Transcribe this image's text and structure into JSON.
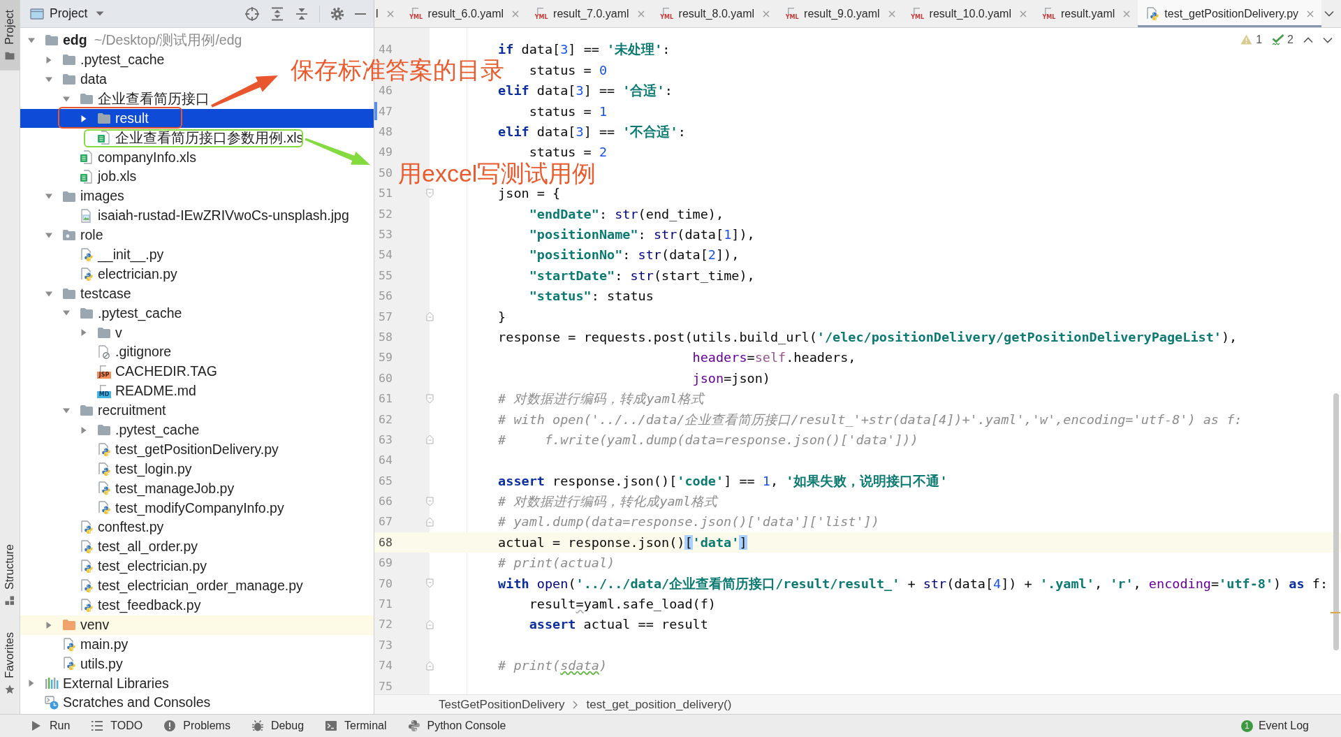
{
  "tool_strip": {
    "tabs": [
      {
        "label": "Project",
        "selected": true
      },
      {
        "label": "Structure",
        "selected": false
      },
      {
        "label": "Favorites",
        "selected": false
      }
    ]
  },
  "project_panel": {
    "title": "Project",
    "tree": [
      {
        "label": "edg",
        "path": "~/Desktop/测试用例/edg",
        "kind": "root",
        "expanded": true,
        "selected": false,
        "highlighted": false,
        "children": [
          {
            "label": ".pytest_cache",
            "kind": "folder",
            "expanded": false,
            "selected": false,
            "highlighted": false
          },
          {
            "label": "data",
            "kind": "folder",
            "expanded": true,
            "selected": false,
            "highlighted": false,
            "children": [
              {
                "label": "企业查看简历接口",
                "kind": "folder",
                "expanded": true,
                "selected": false,
                "highlighted": false,
                "children": [
                  {
                    "label": "result",
                    "kind": "folder",
                    "expanded": false,
                    "selected": true,
                    "highlighted": false
                  },
                  {
                    "label": "企业查看简历接口参数用例.xls",
                    "kind": "xls",
                    "selected": false,
                    "highlighted": false
                  }
                ]
              },
              {
                "label": "companyInfo.xls",
                "kind": "xls",
                "selected": false,
                "highlighted": false
              },
              {
                "label": "job.xls",
                "kind": "xls",
                "selected": false,
                "highlighted": false
              }
            ]
          },
          {
            "label": "images",
            "kind": "folder",
            "expanded": true,
            "selected": false,
            "highlighted": false,
            "children": [
              {
                "label": "isaiah-rustad-IEwZRIVwoCs-unsplash.jpg",
                "kind": "image",
                "selected": false,
                "highlighted": false
              }
            ]
          },
          {
            "label": "role",
            "kind": "package",
            "expanded": true,
            "selected": false,
            "highlighted": false,
            "children": [
              {
                "label": "__init__.py",
                "kind": "python",
                "selected": false,
                "highlighted": false
              },
              {
                "label": "electrician.py",
                "kind": "python",
                "selected": false,
                "highlighted": false
              }
            ]
          },
          {
            "label": "testcase",
            "kind": "folder",
            "expanded": true,
            "selected": false,
            "highlighted": false,
            "children": [
              {
                "label": ".pytest_cache",
                "kind": "folder",
                "expanded": true,
                "selected": false,
                "highlighted": false,
                "children": [
                  {
                    "label": "v",
                    "kind": "folder",
                    "expanded": false,
                    "selected": false,
                    "highlighted": false
                  },
                  {
                    "label": ".gitignore",
                    "kind": "gitignore",
                    "selected": false,
                    "highlighted": false
                  },
                  {
                    "label": "CACHEDIR.TAG",
                    "kind": "jsp",
                    "badge": "JSP",
                    "selected": false,
                    "highlighted": false
                  },
                  {
                    "label": "README.md",
                    "kind": "md",
                    "badge": "MD",
                    "selected": false,
                    "highlighted": false
                  }
                ]
              },
              {
                "label": "recruitment",
                "kind": "folder",
                "expanded": true,
                "selected": false,
                "highlighted": false,
                "children": [
                  {
                    "label": ".pytest_cache",
                    "kind": "folder",
                    "expanded": false,
                    "selected": false,
                    "highlighted": false
                  },
                  {
                    "label": "test_getPositionDelivery.py",
                    "kind": "python",
                    "selected": false,
                    "highlighted": false
                  },
                  {
                    "label": "test_login.py",
                    "kind": "python",
                    "selected": false,
                    "highlighted": false
                  },
                  {
                    "label": "test_manageJob.py",
                    "kind": "python",
                    "selected": false,
                    "highlighted": false
                  },
                  {
                    "label": "test_modifyCompanyInfo.py",
                    "kind": "python",
                    "selected": false,
                    "highlighted": false
                  }
                ]
              },
              {
                "label": "conftest.py",
                "kind": "python",
                "selected": false,
                "highlighted": false
              },
              {
                "label": "test_all_order.py",
                "kind": "python",
                "selected": false,
                "highlighted": false
              },
              {
                "label": "test_electrician.py",
                "kind": "python",
                "selected": false,
                "highlighted": false
              },
              {
                "label": "test_electrician_order_manage.py",
                "kind": "python",
                "selected": false,
                "highlighted": false
              },
              {
                "label": "test_feedback.py",
                "kind": "python",
                "selected": false,
                "highlighted": false
              }
            ]
          },
          {
            "label": "venv",
            "kind": "excluded_folder",
            "expanded": false,
            "selected": false,
            "highlighted": true
          },
          {
            "label": "main.py",
            "kind": "python",
            "selected": false,
            "highlighted": false
          },
          {
            "label": "utils.py",
            "kind": "python",
            "selected": false,
            "highlighted": false
          }
        ]
      },
      {
        "label": "External Libraries",
        "kind": "libraries",
        "expanded": false,
        "selected": false,
        "highlighted": false
      },
      {
        "label": "Scratches and Consoles",
        "kind": "scratches",
        "selected": false,
        "highlighted": false
      }
    ]
  },
  "editor": {
    "tabs": [
      {
        "label": "l",
        "selected": false
      },
      {
        "label": "result_6.0.yaml",
        "kind": "yaml",
        "badge": "YML",
        "selected": false
      },
      {
        "label": "result_7.0.yaml",
        "kind": "yaml",
        "badge": "YML",
        "selected": false
      },
      {
        "label": "result_8.0.yaml",
        "kind": "yaml",
        "badge": "YML",
        "selected": false
      },
      {
        "label": "result_9.0.yaml",
        "kind": "yaml",
        "badge": "YML",
        "selected": false
      },
      {
        "label": "result_10.0.yaml",
        "kind": "yaml",
        "badge": "YML",
        "selected": false
      },
      {
        "label": "result.yaml",
        "kind": "yaml",
        "badge": "YML",
        "selected": false
      },
      {
        "label": "test_getPositionDelivery.py",
        "kind": "python",
        "selected": true
      }
    ],
    "inspections": [
      {
        "kind": "warning",
        "count": "1"
      },
      {
        "kind": "typo",
        "count": "2"
      }
    ],
    "lines": [
      {
        "number": "44",
        "kind": "plain",
        "current": false,
        "tokens": [
          {
            "kind": "keyword",
            "text": "        if"
          },
          {
            "kind": "plain",
            "text": " data["
          },
          {
            "kind": "number",
            "text": "3"
          },
          {
            "kind": "plain",
            "text": "] == "
          },
          {
            "kind": "string",
            "text": "'未处理'"
          },
          {
            "kind": "plain",
            "text": ":"
          }
        ]
      },
      {
        "kind": "plain",
        "current": false,
        "tokens": [
          {
            "kind": "plain",
            "text": "            status = "
          },
          {
            "kind": "number",
            "text": "0"
          }
        ]
      },
      {
        "number": "46",
        "kind": "plain",
        "current": false,
        "tokens": [
          {
            "kind": "keyword",
            "text": "        elif"
          },
          {
            "kind": "plain",
            "text": " data["
          },
          {
            "kind": "number",
            "text": "3"
          },
          {
            "kind": "plain",
            "text": "] == "
          },
          {
            "kind": "string",
            "text": "'合适'"
          },
          {
            "kind": "plain",
            "text": ":"
          }
        ]
      },
      {
        "number": "47",
        "kind": "modified",
        "current": false,
        "tokens": [
          {
            "kind": "plain",
            "text": "            status = "
          },
          {
            "kind": "number",
            "text": "1"
          }
        ]
      },
      {
        "number": "48",
        "kind": "plain",
        "current": false,
        "tokens": [
          {
            "kind": "keyword",
            "text": "        elif"
          },
          {
            "kind": "plain",
            "text": " data["
          },
          {
            "kind": "number",
            "text": "3"
          },
          {
            "kind": "plain",
            "text": "] == "
          },
          {
            "kind": "string",
            "text": "'不合适'"
          },
          {
            "kind": "plain",
            "text": ":"
          }
        ]
      },
      {
        "number": "49",
        "kind": "plain",
        "current": false,
        "tokens": [
          {
            "kind": "plain",
            "text": "            status = "
          },
          {
            "kind": "number",
            "text": "2"
          }
        ]
      },
      {
        "number": "50",
        "kind": "plain",
        "current": false
      },
      {
        "number": "51",
        "kind": "fold_start",
        "current": false,
        "tokens": [
          {
            "kind": "plain",
            "text": "        json = {"
          }
        ]
      },
      {
        "number": "52",
        "kind": "plain",
        "current": false,
        "tokens": [
          {
            "kind": "string",
            "text": "            \"endDate\""
          },
          {
            "kind": "plain",
            "text": ": "
          },
          {
            "kind": "builtin",
            "text": "str"
          },
          {
            "kind": "plain",
            "text": "(end_time),"
          }
        ]
      },
      {
        "number": "53",
        "kind": "plain",
        "current": false,
        "tokens": [
          {
            "kind": "string",
            "text": "            \"positionName\""
          },
          {
            "kind": "plain",
            "text": ": "
          },
          {
            "kind": "builtin",
            "text": "str"
          },
          {
            "kind": "plain",
            "text": "(data["
          },
          {
            "kind": "number",
            "text": "1"
          },
          {
            "kind": "plain",
            "text": "]),"
          }
        ]
      },
      {
        "number": "54",
        "kind": "plain",
        "current": false,
        "tokens": [
          {
            "kind": "string",
            "text": "            \"positionNo\""
          },
          {
            "kind": "plain",
            "text": ": "
          },
          {
            "kind": "builtin",
            "text": "str"
          },
          {
            "kind": "plain",
            "text": "(data["
          },
          {
            "kind": "number",
            "text": "2"
          },
          {
            "kind": "plain",
            "text": "]),"
          }
        ]
      },
      {
        "number": "55",
        "kind": "plain",
        "current": false,
        "tokens": [
          {
            "kind": "string",
            "text": "            \"startDate\""
          },
          {
            "kind": "plain",
            "text": ": "
          },
          {
            "kind": "builtin",
            "text": "str"
          },
          {
            "kind": "plain",
            "text": "(start_time),"
          }
        ]
      },
      {
        "number": "56",
        "kind": "plain",
        "current": false,
        "tokens": [
          {
            "kind": "string",
            "text": "            \"status\""
          },
          {
            "kind": "plain",
            "text": ": status"
          }
        ]
      },
      {
        "number": "57",
        "kind": "fold_end",
        "current": false,
        "tokens": [
          {
            "kind": "plain",
            "text": "        }"
          }
        ]
      },
      {
        "number": "58",
        "kind": "plain",
        "current": false,
        "tokens": [
          {
            "kind": "plain",
            "text": "        response = requests.post(utils.build_url("
          },
          {
            "kind": "string",
            "text": "'/elec/positionDelivery/getPositionDeliveryPageList'"
          },
          {
            "kind": "plain",
            "text": "),"
          }
        ]
      },
      {
        "number": "59",
        "kind": "plain",
        "current": false,
        "tokens": [
          {
            "kind": "param",
            "text": "                                 headers"
          },
          {
            "kind": "plain",
            "text": "="
          },
          {
            "kind": "self",
            "text": "self"
          },
          {
            "kind": "plain",
            "text": ".headers,"
          }
        ]
      },
      {
        "number": "60",
        "kind": "plain",
        "current": false,
        "tokens": [
          {
            "kind": "param",
            "text": "                                 json"
          },
          {
            "kind": "plain",
            "text": "=json)"
          }
        ]
      },
      {
        "number": "61",
        "kind": "fold_start",
        "current": false,
        "tokens": [
          {
            "kind": "comment",
            "text": "        # 对数据进行编码，转成yaml格式"
          }
        ]
      },
      {
        "number": "62",
        "kind": "plain",
        "current": false,
        "tokens": [
          {
            "kind": "comment",
            "text": "        # with open('../../data/企业查看简历接口/result_'+str(data[4])+'.yaml','w',encoding='utf-8') as f:"
          }
        ]
      },
      {
        "number": "63",
        "kind": "fold_end",
        "current": false,
        "tokens": [
          {
            "kind": "comment",
            "text": "        #     f.write(yaml.dump(data=response.json()['data']))"
          }
        ]
      },
      {
        "number": "64",
        "kind": "plain",
        "current": false
      },
      {
        "number": "65",
        "kind": "plain",
        "current": false,
        "tokens": [
          {
            "kind": "keyword",
            "text": "        assert"
          },
          {
            "kind": "plain",
            "text": " response.json()["
          },
          {
            "kind": "string",
            "text": "'code'"
          },
          {
            "kind": "plain",
            "text": "] == "
          },
          {
            "kind": "number",
            "text": "1"
          },
          {
            "kind": "plain",
            "text": ", "
          },
          {
            "kind": "string",
            "text": "'如果失败，说明接口不通'"
          }
        ]
      },
      {
        "number": "66",
        "kind": "fold_start",
        "current": false,
        "tokens": [
          {
            "kind": "comment",
            "text": "        # 对数据进行编码，转化成yaml格式"
          }
        ]
      },
      {
        "number": "67",
        "kind": "fold_end",
        "current": false,
        "tokens": [
          {
            "kind": "comment",
            "text": "        # yaml.dump(data=response.json()['data']['list'])"
          }
        ]
      },
      {
        "number": "68",
        "kind": "plain",
        "current": true,
        "tokens": [
          {
            "kind": "plain",
            "text": "        actual = response.json()"
          },
          {
            "kind": "brace",
            "text": "["
          },
          {
            "kind": "string",
            "text": "'data'"
          },
          {
            "kind": "brace",
            "text": "]"
          }
        ]
      },
      {
        "number": "69",
        "kind": "plain",
        "current": false,
        "tokens": [
          {
            "kind": "comment",
            "text": "        # print(actual)"
          }
        ]
      },
      {
        "number": "70",
        "kind": "fold_start",
        "current": false,
        "tokens": [
          {
            "kind": "keyword",
            "text": "        with "
          },
          {
            "kind": "builtin",
            "text": "open"
          },
          {
            "kind": "plain",
            "text": "("
          },
          {
            "kind": "string",
            "text": "'../../data/企业查看简历接口/result/result_'"
          },
          {
            "kind": "plain",
            "text": " + "
          },
          {
            "kind": "builtin",
            "text": "str"
          },
          {
            "kind": "plain",
            "text": "(data["
          },
          {
            "kind": "number",
            "text": "4"
          },
          {
            "kind": "plain",
            "text": "]) + "
          },
          {
            "kind": "string",
            "text": "'.yaml'"
          },
          {
            "kind": "plain",
            "text": ", "
          },
          {
            "kind": "string",
            "text": "'r'"
          },
          {
            "kind": "plain",
            "text": ", "
          },
          {
            "kind": "param",
            "text": "encoding"
          },
          {
            "kind": "plain",
            "text": "="
          },
          {
            "kind": "string",
            "text": "'utf-8'"
          },
          {
            "kind": "plain",
            "text": ") "
          },
          {
            "kind": "keyword",
            "text": "as"
          },
          {
            "kind": "plain",
            "text": " f:"
          }
        ]
      },
      {
        "number": "71",
        "kind": "plain",
        "current": false,
        "tokens": [
          {
            "kind": "plain",
            "text": "            result"
          },
          {
            "kind": "warn",
            "text": "="
          },
          {
            "kind": "plain",
            "text": "yaml.safe_load(f)"
          }
        ]
      },
      {
        "number": "72",
        "kind": "fold_end",
        "current": false,
        "tokens": [
          {
            "kind": "keyword",
            "text": "            assert"
          },
          {
            "kind": "plain",
            "text": " actual == result"
          }
        ]
      },
      {
        "number": "73",
        "kind": "plain",
        "current": false
      },
      {
        "number": "74",
        "kind": "fold_end",
        "current": false,
        "tokens": [
          {
            "kind": "comment",
            "text": "        # print("
          },
          {
            "kind": "typo",
            "text": "sdata"
          },
          {
            "kind": "comment",
            "text": ")"
          }
        ]
      },
      {
        "number": "75",
        "kind": "plain",
        "current": false
      }
    ],
    "breadcrumbs": [
      "TestGetPositionDelivery",
      "test_get_position_delivery()"
    ]
  },
  "annotations": [
    {
      "text": "保存标准答案的目录",
      "color": "#e9552c"
    },
    {
      "text": "用excel写测试用例",
      "color": "#84db3f"
    }
  ],
  "bottom_bar": {
    "tools": [
      {
        "label": "Run",
        "kind": "run"
      },
      {
        "label": "TODO",
        "kind": "todo"
      },
      {
        "label": "Problems",
        "kind": "problems"
      },
      {
        "label": "Debug",
        "kind": "debug"
      },
      {
        "label": "Terminal",
        "kind": "terminal"
      },
      {
        "label": "Python Console",
        "kind": "console"
      }
    ],
    "event_log": {
      "label": "Event Log",
      "badge": "1"
    }
  }
}
